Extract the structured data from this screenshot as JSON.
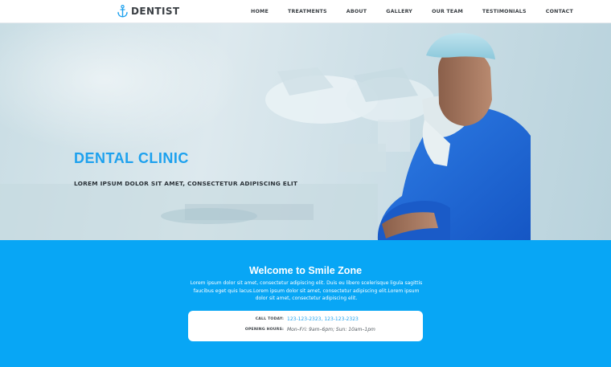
{
  "header": {
    "logo_text": "DENTIST",
    "nav": [
      "HOME",
      "TREATMENTS",
      "ABOUT",
      "GALLERY",
      "OUR TEAM",
      "TESTIMONIALS",
      "CONTACT"
    ]
  },
  "hero": {
    "title": "DENTAL CLINIC",
    "subtitle": "LOREM IPSUM DOLOR SIT AMET, CONSECTETUR ADIPISCING ELIT"
  },
  "welcome": {
    "title": "Welcome to Smile Zone",
    "text": "Lorem ipsum dolor sit amet, consectetur adipiscing elit. Duis eu libero scelerisque ligula sagittis faucibus eget quis lacus.Lorem ipsum dolor sit amet, consectetur adipiscing elit.Lorem ipsum dolor sit amet, consectetur adipiscing elit.",
    "call_label": "CALL TODAY:",
    "call_value": "123-123-2323, 123-123-2323",
    "hours_label": "OPENING HOURS:",
    "hours_value": "Mon–Fri: 9am–6pm; Sun: 10am–1pm"
  },
  "colors": {
    "accent": "#1da1ee",
    "band": "#08a6f5",
    "text_dark": "#3a3f44"
  },
  "icons": {
    "logo": "anchor-icon"
  }
}
